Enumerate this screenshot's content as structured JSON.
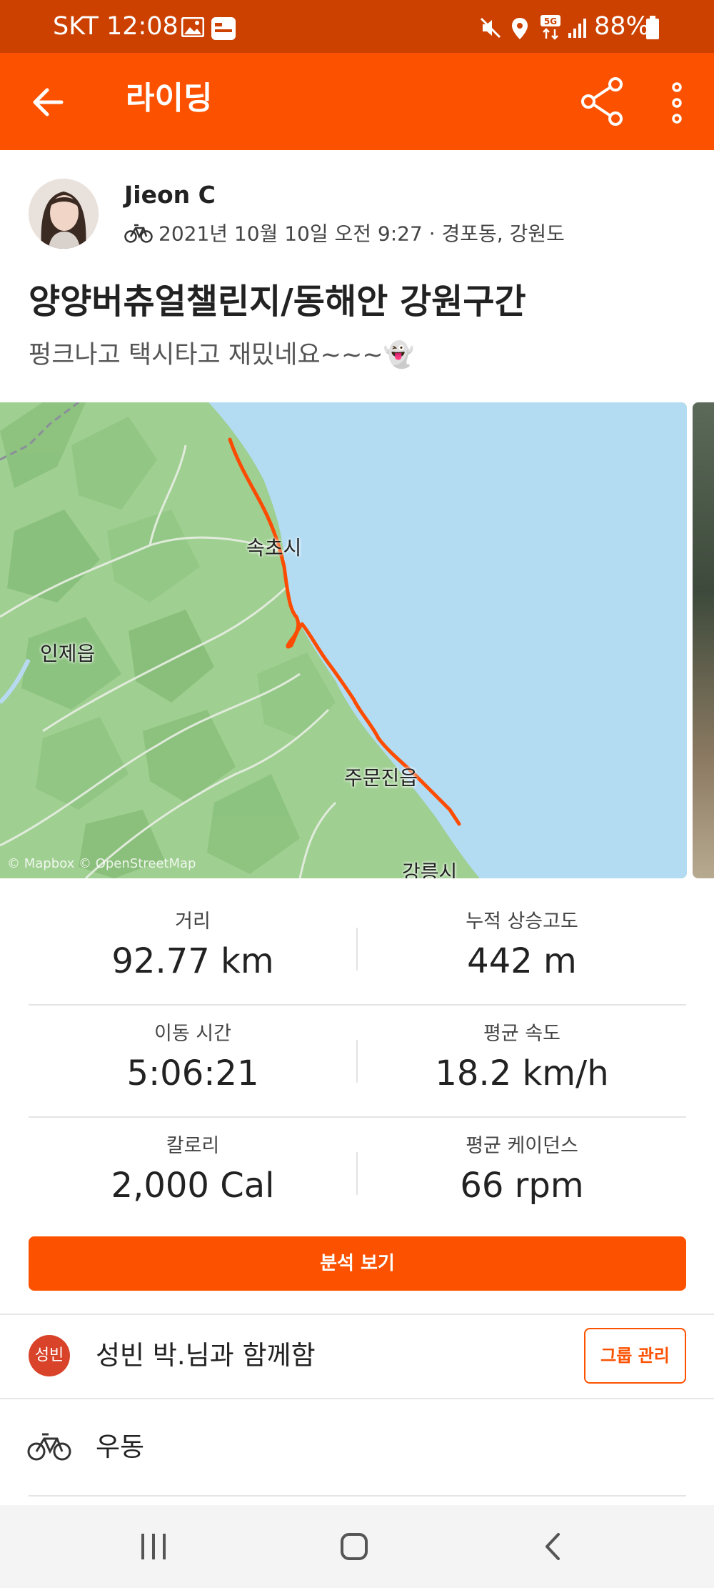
{
  "status_bar": {
    "time": "SKT 12:08",
    "battery": "88%"
  },
  "app_bar": {
    "title": "라이딩"
  },
  "athlete": {
    "name": "Jieon C",
    "meta": "2021년 10월 10일 오전 9:27 · 경포동, 강원도"
  },
  "activity": {
    "title": "양양버츄얼챌린지/동해안 강원구간",
    "description": "펑크나고 택시타고 재밌네요~~~👻"
  },
  "map": {
    "labels": {
      "sokcho": "속초시",
      "inje": "인제읍",
      "jumunjin": "주문진읍",
      "gangneung": "강릉시"
    },
    "attribution": "© Mapbox © OpenStreetMap",
    "route_color": "#fc4c02",
    "sea_color": "#b3dcf3"
  },
  "stats": [
    {
      "label": "거리",
      "value": "92.77 km"
    },
    {
      "label": "누적 상승고도",
      "value": "442 m"
    },
    {
      "label": "이동 시간",
      "value": "5:06:21"
    },
    {
      "label": "평균 속도",
      "value": "18.2 km/h"
    },
    {
      "label": "칼로리",
      "value": "2,000 Cal"
    },
    {
      "label": "평균 케이던스",
      "value": "66 rpm"
    }
  ],
  "analysis_button": "분석 보기",
  "group": {
    "badge": "성빈",
    "text": "성빈 박.님과 함께함",
    "manage_button": "그룹 관리"
  },
  "gear": {
    "name": "우동"
  },
  "colors": {
    "brand": "#fc5200",
    "status_bar": "#cc4100"
  }
}
